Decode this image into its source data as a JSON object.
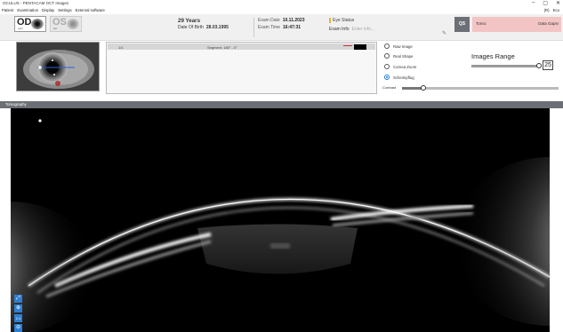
{
  "window": {
    "title": "OCULUS - PENTACAM OCT Images",
    "controls": [
      "–",
      "▢",
      "✕"
    ]
  },
  "menu": {
    "items": [
      "Patient",
      "Examination",
      "Display",
      "Settings",
      "External software"
    ],
    "right": [
      "(R)",
      "Eco"
    ]
  },
  "eye_select": {
    "od": {
      "label": "OD",
      "sub": "right"
    },
    "os": {
      "label": "OS",
      "sub": "left"
    }
  },
  "patient": {
    "age": "29 Years",
    "dob_label": "Date Of Birth",
    "dob_value": "28.03.1995"
  },
  "exam": {
    "date_label": "Exam Date",
    "date_value": "10.11.2023",
    "time_label": "Exam Time",
    "time_value": "16:47:31"
  },
  "eye_status": {
    "title": "Eye Status",
    "info_label": "Exam Info",
    "info_placeholder": "Enter info..."
  },
  "qs_label": "QS",
  "alert": {
    "left": "Tomo:",
    "right": "Data Gaps!"
  },
  "segment": {
    "index": "1/1",
    "label": "Segment: 180° - 0°"
  },
  "view_options": [
    {
      "label": "Raw Image",
      "selected": false
    },
    {
      "label": "Real Shape",
      "selected": false
    },
    {
      "label": "Cornea Zoom",
      "selected": false
    },
    {
      "label": "Scheimpflug",
      "selected": true
    }
  ],
  "images_range": {
    "title": "Images Range",
    "value": "25"
  },
  "contrast_label": "Contrast",
  "section_header": "Tomography",
  "zoom_controls": [
    "⤢",
    "⊕",
    "1:1",
    "⊖"
  ],
  "colors": {
    "accent_blue": "#2e7fd2",
    "header_gray": "#6c6f75",
    "alert_bg": "#f2c4c4",
    "status_accent": "#e7b23b"
  }
}
